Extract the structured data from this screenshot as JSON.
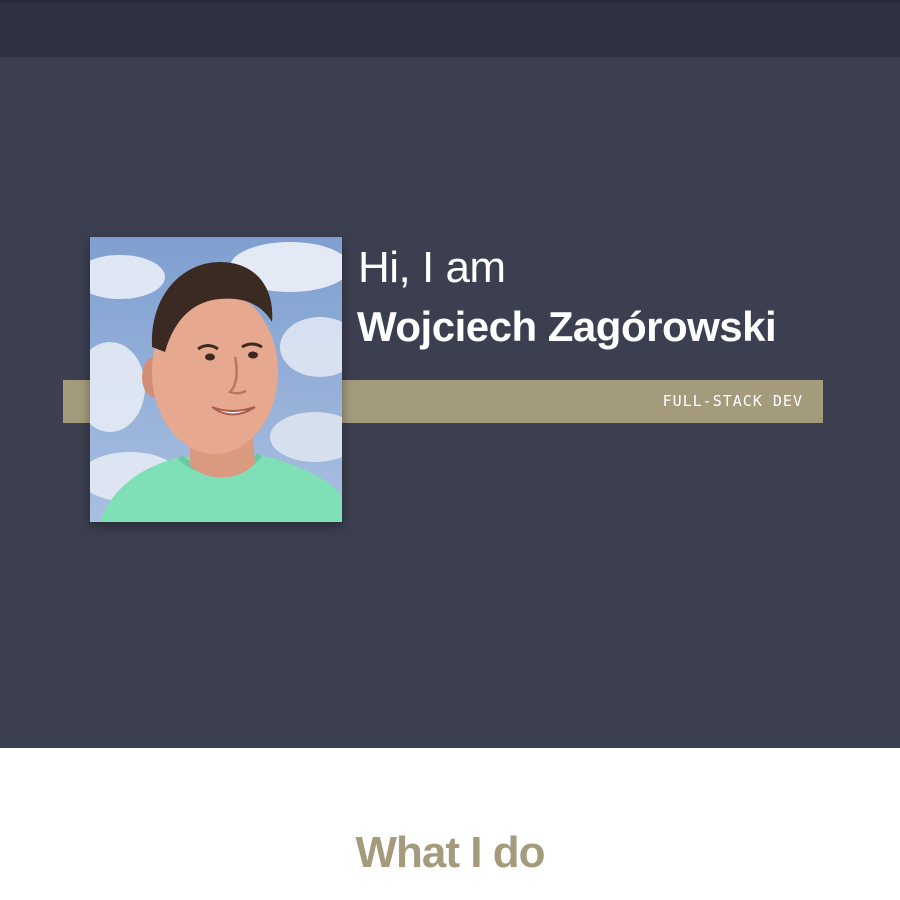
{
  "hero": {
    "greeting": "Hi, I am",
    "name": "Wojciech Zagórowski",
    "role": "FULL-STACK DEV",
    "photo_alt": "Wojciech Zagórowski"
  },
  "section": {
    "title": "What I do"
  },
  "colors": {
    "topbar": "#2f3241",
    "hero_background": "#3c3f50",
    "accent": "#a49a7c",
    "text_light": "#ffffff"
  }
}
